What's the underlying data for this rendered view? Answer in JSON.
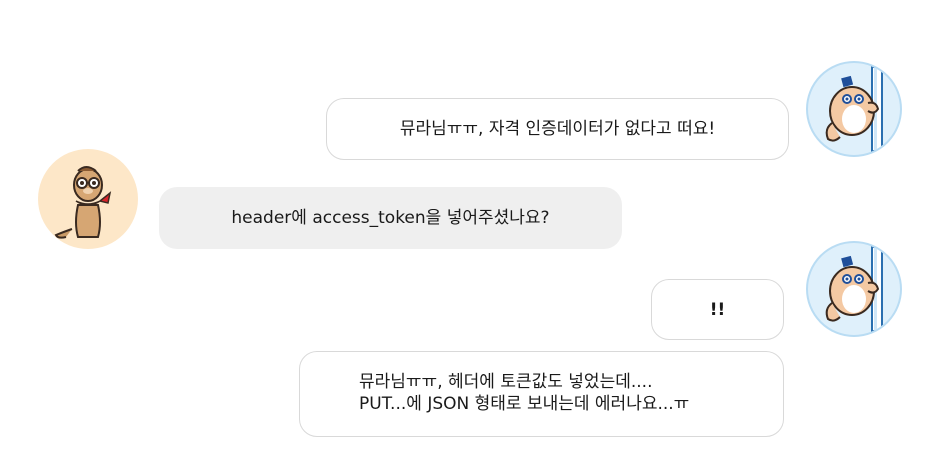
{
  "conversation": {
    "messages": [
      {
        "sender": "user",
        "lines": [
          "뮤라님ㅠㅠ, 자격 인증데이터가 없다고 떠요!"
        ]
      },
      {
        "sender": "bot",
        "lines": [
          "header에 access_token을 넣어주셨나요?"
        ]
      },
      {
        "sender": "user",
        "lines": [
          "!!"
        ]
      },
      {
        "sender": "user",
        "lines": [
          "뮤라님ㅠㅠ, 헤더에 토큰값도 넣었는데....",
          "PUT...에 JSON 형태로 보내는데 에러나요...ㅠ"
        ]
      }
    ]
  },
  "colors": {
    "user_avatar_bg": "#dff0fb",
    "bot_avatar_bg": "#fde7c8",
    "incoming_bubble_bg": "#efefef",
    "outgoing_bubble_border": "#d9d9d9"
  },
  "icons": {
    "user_avatar": "hamster-peeking-icon",
    "bot_avatar": "meerkat-with-scarf-icon"
  }
}
